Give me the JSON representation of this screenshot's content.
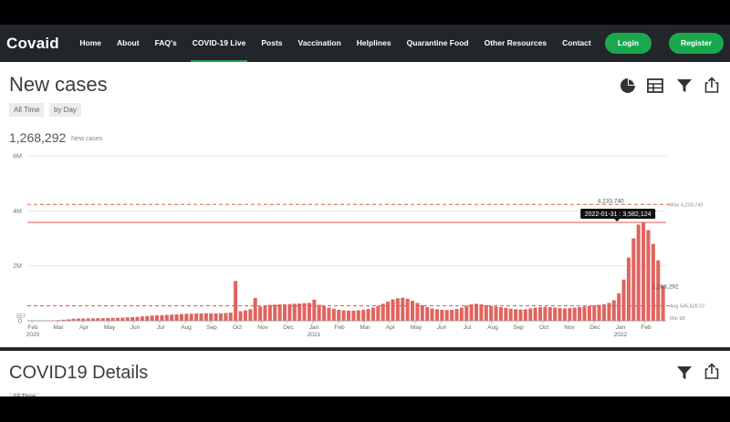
{
  "nav": {
    "brand": "Covaid",
    "items": [
      "Home",
      "About",
      "FAQ's",
      "COVID-19 Live",
      "Posts",
      "Vaccination",
      "Helplines",
      "Quarantine Food",
      "Other Resources",
      "Contact"
    ],
    "active_index": 3,
    "login_label": "Login",
    "register_label": "Register"
  },
  "panel1": {
    "title": "New cases",
    "filters": [
      "All Time",
      "by Day"
    ],
    "value": "1,268,292",
    "value_unit": "New cases",
    "icons": [
      "pie-chart-icon",
      "table-icon",
      "filter-icon",
      "share-icon"
    ]
  },
  "chart_data": {
    "type": "bar",
    "title": "",
    "ylim": [
      0,
      6000000
    ],
    "y_ticks": [
      "0",
      "2M",
      "4M",
      "6M"
    ],
    "x_labels": [
      {
        "month": "Feb",
        "year": "2020"
      },
      {
        "month": "Mar",
        "year": ""
      },
      {
        "month": "Apr",
        "year": ""
      },
      {
        "month": "May",
        "year": ""
      },
      {
        "month": "Jun",
        "year": ""
      },
      {
        "month": "Jul",
        "year": ""
      },
      {
        "month": "Aug",
        "year": ""
      },
      {
        "month": "Sep",
        "year": ""
      },
      {
        "month": "Oct",
        "year": ""
      },
      {
        "month": "Nov",
        "year": ""
      },
      {
        "month": "Dec",
        "year": ""
      },
      {
        "month": "Jan",
        "year": "2021"
      },
      {
        "month": "Feb",
        "year": ""
      },
      {
        "month": "Mar",
        "year": ""
      },
      {
        "month": "Apr",
        "year": ""
      },
      {
        "month": "May",
        "year": ""
      },
      {
        "month": "Jun",
        "year": ""
      },
      {
        "month": "Jul",
        "year": ""
      },
      {
        "month": "Aug",
        "year": ""
      },
      {
        "month": "Sep",
        "year": ""
      },
      {
        "month": "Oct",
        "year": ""
      },
      {
        "month": "Nov",
        "year": ""
      },
      {
        "month": "Dec",
        "year": ""
      },
      {
        "month": "Jan",
        "year": "2022"
      },
      {
        "month": "Feb",
        "year": ""
      }
    ],
    "series_color": "#e0645e",
    "weekly_values": [
      1000,
      3000,
      5000,
      8000,
      10000,
      15000,
      25000,
      40000,
      55000,
      75000,
      85000,
      85000,
      90000,
      90000,
      95000,
      95000,
      100000,
      105000,
      110000,
      115000,
      125000,
      135000,
      145000,
      160000,
      175000,
      190000,
      200000,
      205000,
      215000,
      225000,
      235000,
      245000,
      255000,
      260000,
      265000,
      270000,
      275000,
      270000,
      270000,
      275000,
      285000,
      300000,
      320000,
      350000,
      380000,
      420000,
      470000,
      520000,
      560000,
      580000,
      590000,
      600000,
      600000,
      610000,
      620000,
      630000,
      640000,
      650000,
      620000,
      580000,
      530000,
      480000,
      440000,
      400000,
      380000,
      370000,
      370000,
      380000,
      400000,
      430000,
      480000,
      540000,
      620000,
      700000,
      780000,
      820000,
      840000,
      800000,
      730000,
      650000,
      570000,
      500000,
      450000,
      420000,
      400000,
      390000,
      400000,
      430000,
      480000,
      550000,
      600000,
      620000,
      600000,
      570000,
      540000,
      520000,
      500000,
      470000,
      440000,
      420000,
      410000,
      420000,
      450000,
      480000,
      500000,
      510000,
      500000,
      480000,
      460000,
      450000,
      460000,
      480000,
      500000,
      520000,
      540000,
      560000,
      580000,
      600000,
      650000,
      750000,
      1000000,
      1500000,
      2300000,
      3000000,
      3500000,
      3582124,
      3300000,
      2800000,
      2200000,
      1268292
    ],
    "spikes": [
      {
        "week": 42,
        "value": 1450000
      },
      {
        "week": 46,
        "value": 830000
      },
      {
        "week": 58,
        "value": 770000
      }
    ],
    "max_value": 4233740,
    "max_label": "4,233,740",
    "max_line_label": "Max 4,233,740",
    "avg_value": 545628,
    "avg_label": "Avg 545,628.07",
    "min_value": 98,
    "min_label": "Min 98",
    "start_label": "557",
    "current_label": "1,268,292",
    "highlight": {
      "week": 120,
      "value": 3582124,
      "label": "2022-01-31 : 3,582,124"
    }
  },
  "panel2": {
    "title": "COVID19 Details",
    "filter": "All Time",
    "icons": [
      "filter-icon",
      "share-icon"
    ]
  }
}
